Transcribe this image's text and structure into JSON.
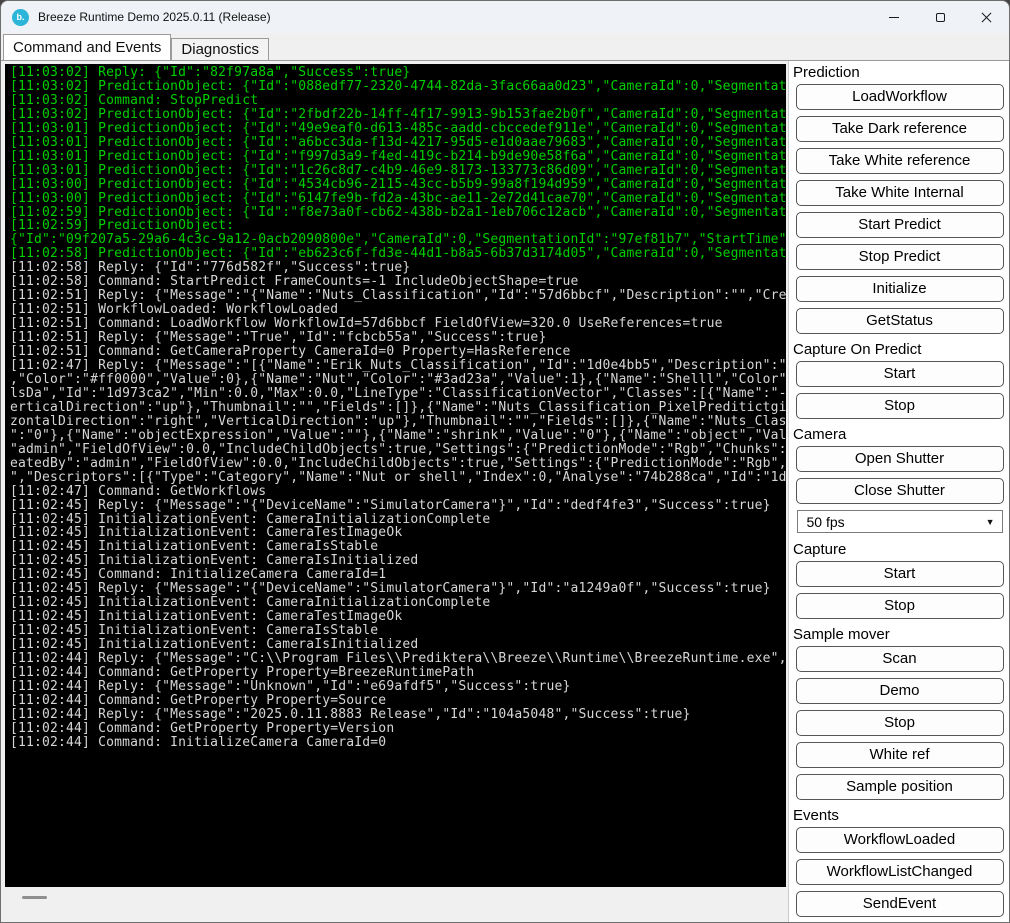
{
  "window": {
    "title": "Breeze Runtime Demo 2025.0.11 (Release)",
    "icon_letter": "b.",
    "icon_color": "#2bb5d8",
    "controls": {
      "minimize": "minimize-icon",
      "maximize": "maximize-icon",
      "close": "close-icon"
    }
  },
  "tabs": [
    {
      "label": "Command and Events",
      "active": true
    },
    {
      "label": "Diagnostics",
      "active": false
    }
  ],
  "console": {
    "bg": "#000000",
    "green": "#00d000",
    "gray": "#d6d6d6",
    "lines": [
      {
        "c": "g",
        "t": "[11:03:02] Reply: {\"Id\":\"82f97a8a\",\"Success\":true}"
      },
      {
        "c": "g",
        "t": "[11:03:02] PredictionObject: {\"Id\":\"088edf77-2320-4744-82da-3fac66aa0d23\",\"CameraId\":0,\"Segmentat"
      },
      {
        "c": "g",
        "t": "[11:03:02] Command: StopPredict"
      },
      {
        "c": "g",
        "t": "[11:03:02] PredictionObject: {\"Id\":\"2fbdf22b-14ff-4f17-9913-9b153fae2b0f\",\"CameraId\":0,\"Segmentat"
      },
      {
        "c": "g",
        "t": "[11:03:01] PredictionObject: {\"Id\":\"49e9eaf0-d613-485c-aadd-cbccedef911e\",\"CameraId\":0,\"Segmentat"
      },
      {
        "c": "g",
        "t": "[11:03:01] PredictionObject: {\"Id\":\"a6bcc3da-f13d-4217-95d5-e1d0aae79683\",\"CameraId\":0,\"Segmentat"
      },
      {
        "c": "g",
        "t": "[11:03:01] PredictionObject: {\"Id\":\"f997d3a9-f4ed-419c-b214-b9de90e58f6a\",\"CameraId\":0,\"Segmentat"
      },
      {
        "c": "g",
        "t": "[11:03:01] PredictionObject: {\"Id\":\"1c26c8d7-c4b9-46e9-8173-133773c86d09\",\"CameraId\":0,\"Segmentat"
      },
      {
        "c": "g",
        "t": "[11:03:00] PredictionObject: {\"Id\":\"4534cb96-2115-43cc-b5b9-99a8f194d959\",\"CameraId\":0,\"Segmentat"
      },
      {
        "c": "g",
        "t": "[11:03:00] PredictionObject: {\"Id\":\"6147fe9b-fd2a-43bc-ae11-2e72d41cae70\",\"CameraId\":0,\"Segmentat"
      },
      {
        "c": "g",
        "t": "[11:02:59] PredictionObject: {\"Id\":\"f8e73a0f-cb62-438b-b2a1-1eb706c12acb\",\"CameraId\":0,\"Segmentat"
      },
      {
        "c": "g",
        "t": "[11:02:59] PredictionObject:"
      },
      {
        "c": "g",
        "t": "{\"Id\":\"09f207a5-29a6-4c3c-9a12-0acb2090800e\",\"CameraId\":0,\"SegmentationId\":\"97ef81b7\",\"StartTime\""
      },
      {
        "c": "g",
        "t": "[11:02:58] PredictionObject: {\"Id\":\"eb623c6f-fd3e-44d1-b8a5-6b37d3174d05\",\"CameraId\":0,\"Segmentat"
      },
      {
        "c": "w",
        "t": "[11:02:58] Reply: {\"Id\":\"776d582f\",\"Success\":true}"
      },
      {
        "c": "w",
        "t": "[11:02:58] Command: StartPredict FrameCounts=-1 IncludeObjectShape=true"
      },
      {
        "c": "w",
        "t": "[11:02:51] Reply: {\"Message\":\"{\"Name\":\"Nuts_Classification\",\"Id\":\"57d6bbcf\",\"Description\":\"\",\"Cre"
      },
      {
        "c": "w",
        "t": "[11:02:51] WorkflowLoaded: WorkflowLoaded"
      },
      {
        "c": "w",
        "t": "[11:02:51] Command: LoadWorkflow WorkflowId=57d6bbcf FieldOfView=320.0 UseReferences=true"
      },
      {
        "c": "w",
        "t": "[11:02:51] Reply: {\"Message\":\"True\",\"Id\":\"fcbcb55a\",\"Success\":true}"
      },
      {
        "c": "w",
        "t": "[11:02:51] Command: GetCameraProperty CameraId=0 Property=HasReference"
      },
      {
        "c": "w",
        "t": "[11:02:47] Reply: {\"Message\":\"[{\"Name\":\"Erik_Nuts_Classification\",\"Id\":\"1d0e4bb5\",\"Description\":\""
      },
      {
        "c": "w",
        "t": ",\"Color\":\"#ff0000\",\"Value\":0},{\"Name\":\"Nut\",\"Color\":\"#3ad23a\",\"Value\":1},{\"Name\":\"Shelll\",\"Color\""
      },
      {
        "c": "w",
        "t": "lsDa\",\"Id\":\"1d973ca2\",\"Min\":0.0,\"Max\":0.0,\"LineType\":\"ClassificationVector\",\"Classes\":[{\"Name\":\"-"
      },
      {
        "c": "w",
        "t": "erticalDirection\":\"up\"},\"Thumbnail\":\"\",\"Fields\":[]},{\"Name\":\"Nuts_Classification_PixelPreditictgi"
      },
      {
        "c": "w",
        "t": "zontalDirection\":\"right\",\"VerticalDirection\":\"up\"},\"Thumbnail\":\"\",\"Fields\":[]},{\"Name\":\"Nuts_Clas"
      },
      {
        "c": "w",
        "t": "\":\"0\"},{\"Name\":\"objectExpression\",\"Value\":\"\"},{\"Name\":\"shrink\",\"Value\":\"0\"},{\"Name\":\"object\",\"Val"
      },
      {
        "c": "w",
        "t": "\"admin\",\"FieldOfView\":0.0,\"IncludeChildObjects\":true,\"Settings\":{\"PredictionMode\":\"Rgb\",\"Chunks\":"
      },
      {
        "c": "w",
        "t": "eatedBy\":\"admin\",\"FieldOfView\":0.0,\"IncludeChildObjects\":true,\"Settings\":{\"PredictionMode\":\"Rgb\","
      },
      {
        "c": "w",
        "t": "\",\"Descriptors\":[{\"Type\":\"Category\",\"Name\":\"Nut or shell\",\"Index\":0,\"Analyse\":\"74b288ca\",\"Id\":\"1d"
      },
      {
        "c": "w",
        "t": "[11:02:47] Command: GetWorkflows"
      },
      {
        "c": "w",
        "t": "[11:02:45] Reply: {\"Message\":\"{\"DeviceName\":\"SimulatorCamera\"}\",\"Id\":\"dedf4fe3\",\"Success\":true}"
      },
      {
        "c": "w",
        "t": "[11:02:45] InitializationEvent: CameraInitializationComplete"
      },
      {
        "c": "w",
        "t": "[11:02:45] InitializationEvent: CameraTestImageOk"
      },
      {
        "c": "w",
        "t": "[11:02:45] InitializationEvent: CameraIsStable"
      },
      {
        "c": "w",
        "t": "[11:02:45] InitializationEvent: CameraIsInitialized"
      },
      {
        "c": "w",
        "t": "[11:02:45] Command: InitializeCamera CameraId=1"
      },
      {
        "c": "w",
        "t": "[11:02:45] Reply: {\"Message\":\"{\"DeviceName\":\"SimulatorCamera\"}\",\"Id\":\"a1249a0f\",\"Success\":true}"
      },
      {
        "c": "w",
        "t": "[11:02:45] InitializationEvent: CameraInitializationComplete"
      },
      {
        "c": "w",
        "t": "[11:02:45] InitializationEvent: CameraTestImageOk"
      },
      {
        "c": "w",
        "t": "[11:02:45] InitializationEvent: CameraIsStable"
      },
      {
        "c": "w",
        "t": "[11:02:45] InitializationEvent: CameraIsInitialized"
      },
      {
        "c": "w",
        "t": "[11:02:44] Reply: {\"Message\":\"C:\\\\Program Files\\\\Prediktera\\\\Breeze\\\\Runtime\\\\BreezeRuntime.exe\","
      },
      {
        "c": "w",
        "t": "[11:02:44] Command: GetProperty Property=BreezeRuntimePath"
      },
      {
        "c": "w",
        "t": "[11:02:44] Reply: {\"Message\":\"Unknown\",\"Id\":\"e69afdf5\",\"Success\":true}"
      },
      {
        "c": "w",
        "t": "[11:02:44] Command: GetProperty Property=Source"
      },
      {
        "c": "w",
        "t": "[11:02:44] Reply: {\"Message\":\"2025.0.11.8883 Release\",\"Id\":\"104a5048\",\"Success\":true}"
      },
      {
        "c": "w",
        "t": "[11:02:44] Command: GetProperty Property=Version"
      },
      {
        "c": "w",
        "t": "[11:02:44] Command: InitializeCamera CameraId=0"
      }
    ]
  },
  "panel": {
    "sections": [
      {
        "label": "Prediction",
        "items": [
          {
            "label": "LoadWorkflow"
          },
          {
            "label": "Take Dark reference"
          },
          {
            "label": "Take White reference"
          },
          {
            "label": "Take White Internal"
          },
          {
            "label": "Start Predict"
          },
          {
            "label": "Stop Predict"
          },
          {
            "label": "Initialize"
          },
          {
            "label": "GetStatus"
          }
        ]
      },
      {
        "label": "Capture On Predict",
        "items": [
          {
            "label": "Start"
          },
          {
            "label": "Stop"
          }
        ]
      },
      {
        "label": "Camera",
        "items": [
          {
            "label": "Open Shutter"
          },
          {
            "label": "Close Shutter"
          },
          {
            "type": "select",
            "name": "fps-select",
            "value": "50 fps"
          }
        ]
      },
      {
        "label": "Capture",
        "items": [
          {
            "label": "Start"
          },
          {
            "label": "Stop"
          }
        ]
      },
      {
        "label": "Sample mover",
        "items": [
          {
            "label": "Scan"
          },
          {
            "label": "Demo"
          },
          {
            "label": "Stop"
          },
          {
            "label": "White ref"
          },
          {
            "label": "Sample position"
          }
        ]
      },
      {
        "label": "Events",
        "items": [
          {
            "label": "WorkflowLoaded"
          },
          {
            "label": "WorkflowListChanged"
          },
          {
            "label": "SendEvent"
          }
        ]
      }
    ]
  }
}
